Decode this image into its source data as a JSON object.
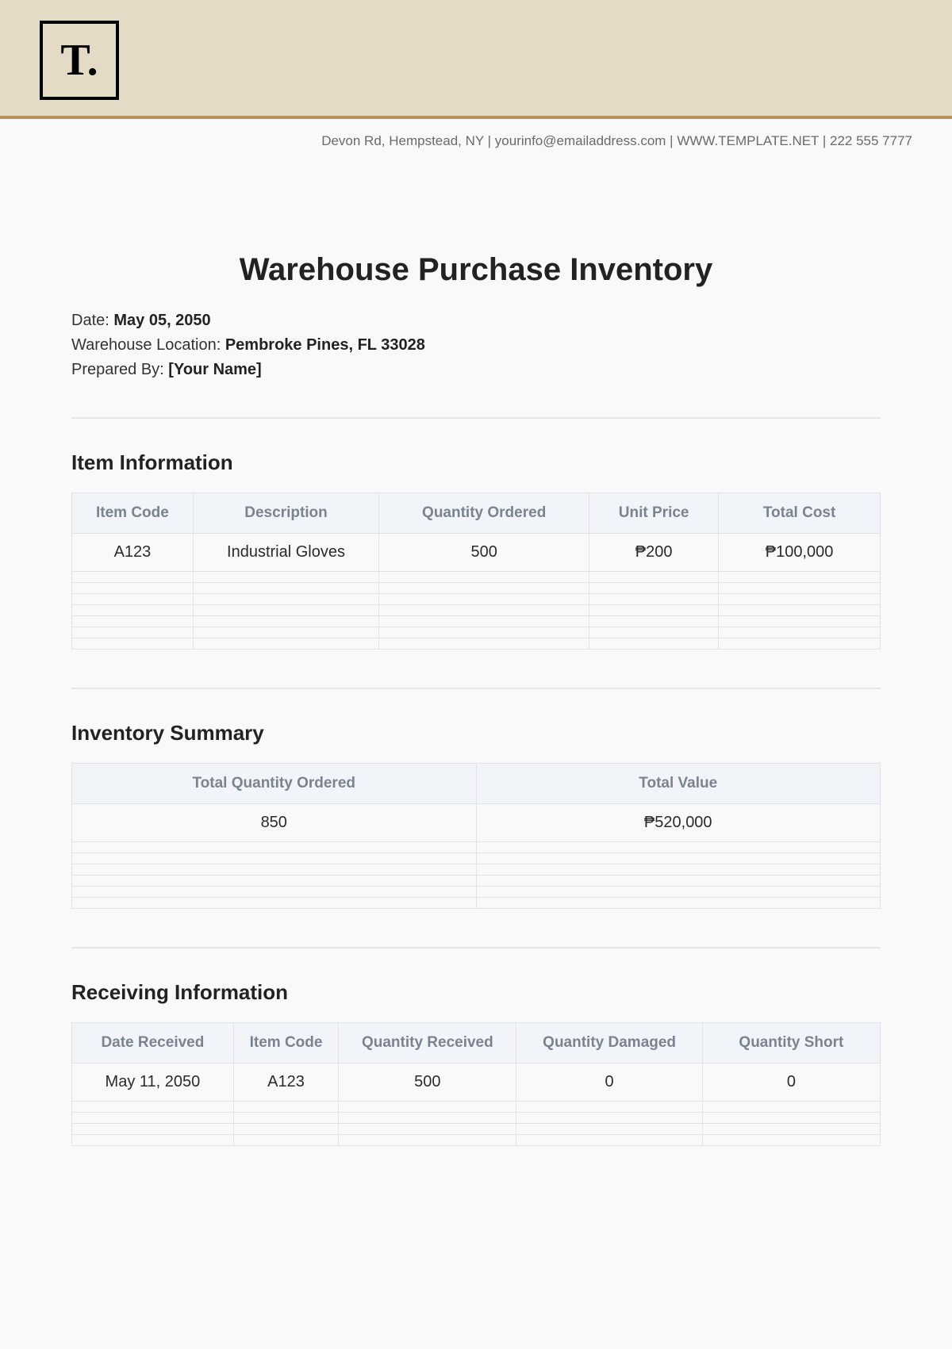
{
  "logo_text": "T.",
  "contact_line": "Devon Rd, Hempstead, NY | yourinfo@emailaddress.com | WWW.TEMPLATE.NET | 222 555 7777",
  "title": "Warehouse Purchase Inventory",
  "meta": {
    "date_label": "Date: ",
    "date_value": "May 05, 2050",
    "location_label": "Warehouse Location: ",
    "location_value": "Pembroke Pines, FL 33028",
    "prepared_label": "Prepared By: ",
    "prepared_value": "[Your Name]"
  },
  "item_info": {
    "heading": "Item Information",
    "headers": {
      "code": "Item Code",
      "desc": "Description",
      "qty": "Quantity Ordered",
      "unit": "Unit Price",
      "total": "Total Cost"
    },
    "row": {
      "code": "A123",
      "desc": "Industrial Gloves",
      "qty": "500",
      "unit": "₱200",
      "total": "₱100,000"
    }
  },
  "summary": {
    "heading": "Inventory Summary",
    "headers": {
      "qty": "Total Quantity Ordered",
      "value": "Total Value"
    },
    "row": {
      "qty": "850",
      "value": "₱520,000"
    }
  },
  "receiving": {
    "heading": "Receiving Information",
    "headers": {
      "date": "Date Received",
      "code": "Item Code",
      "qty_recv": "Quantity Received",
      "qty_dmg": "Quantity Damaged",
      "qty_short": "Quantity Short"
    },
    "row": {
      "date": "May 11, 2050",
      "code": "A123",
      "qty_recv": "500",
      "qty_dmg": "0",
      "qty_short": "0"
    }
  }
}
